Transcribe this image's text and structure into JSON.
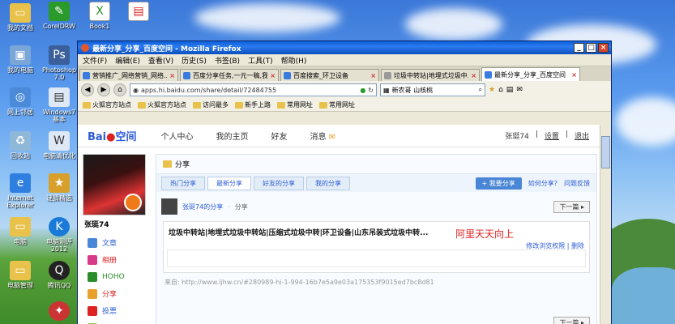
{
  "desktop": {
    "icons_left": [
      "我的文档",
      "我的电脑",
      "网上邻居",
      "回收站",
      "Internet Explorer",
      "电脑",
      "电脑管理"
    ],
    "icons_col2": [
      "CorelDRW",
      "Photoshop 7.0",
      "Windows7基本",
      "电脑清优化",
      "谜猜精选",
      "电脑测评2012",
      "腾讯QQ"
    ],
    "icons_top": [
      "Book1",
      ""
    ]
  },
  "window": {
    "title": "最新分享_分享_百度空间 - Mozilla Firefox",
    "menu": [
      "文件(F)",
      "编辑(E)",
      "查看(V)",
      "历史(S)",
      "书签(B)",
      "工具(T)",
      "帮助(H)"
    ],
    "tabs": [
      "营销推广_网络营销_网络...",
      "百度分享任务,一元一稿,我...",
      "百度搜索_环卫设备",
      "垃圾中转站|地埋式垃圾中...",
      "最新分享_分享_百度空间"
    ],
    "url": "apps.hi.baidu.com/share/detail/72484755",
    "search_text": "新农哥 山核桃",
    "bookmarks": [
      "火狐官方站点",
      "火狐官方站点",
      "访问最多",
      "新手上路",
      "常用网址",
      "常用网址"
    ]
  },
  "page": {
    "logo": "Bai",
    "logo_suffix": "空间",
    "nav": [
      "个人中心",
      "我的主页",
      "好友",
      "消息"
    ],
    "user_right": [
      "张珽74",
      "设置",
      "退出"
    ],
    "username": "张珽74",
    "side_items": [
      "文章",
      "相册",
      "HOHO",
      "分享",
      "投票",
      "测试"
    ],
    "section_title": "分享",
    "content_tabs": [
      "热门分享",
      "最新分享",
      "好友的分享",
      "我的分享"
    ],
    "share_button": "+ 我要分享",
    "how_share": "如何分享?",
    "feedback": "问题反馈",
    "post_author": "张珽74的分享",
    "post_kind": "分享",
    "next_label": "下一篇",
    "post_title": "垃圾中转站|地埋式垃圾中转站|压缩式垃圾中转|环卫设备|山东吊装式垃圾中转...",
    "highlight": "阿里天天向上",
    "edit_links": "修改浏览权限 | 删除",
    "source": "来自: http://www.ljhw.cn/#280989-hi-1-994-16b7e5a9e03a175353f9015ed7bc8d81"
  }
}
